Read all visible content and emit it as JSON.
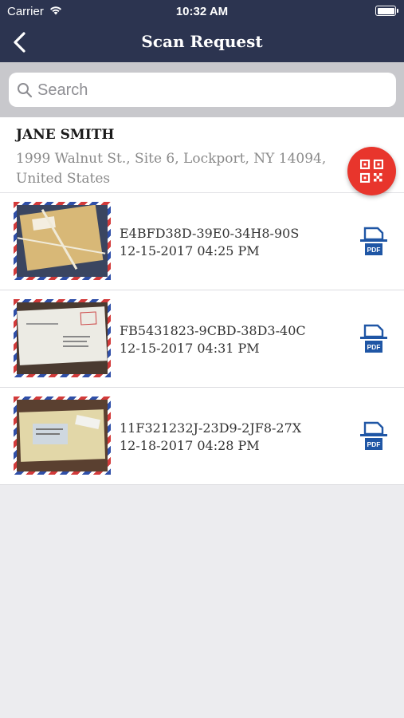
{
  "status_bar": {
    "carrier": "Carrier",
    "time": "10:32 AM"
  },
  "nav": {
    "title": "Scan Request"
  },
  "search": {
    "placeholder": "Search",
    "value": ""
  },
  "customer": {
    "name": "JANE SMITH",
    "address": "1999 Walnut St., Site 6, Lockport, NY 14094, United States"
  },
  "scans": [
    {
      "id": "E4BFD38D-39E0-34H8-90S",
      "date": "12-15-2017 04:25 PM"
    },
    {
      "id": "FB5431823-9CBD-38D3-40C",
      "date": "12-15-2017 04:31 PM"
    },
    {
      "id": "11F321232J-23D9-2JF8-27X",
      "date": "12-18-2017 04:28 PM"
    }
  ],
  "pdf_label": "PDF",
  "colors": {
    "navbar": "#2c3450",
    "accent": "#e8352c",
    "pdf_blue": "#1f56a5"
  },
  "icons": {
    "back": "chevron-left-icon",
    "search": "search-icon",
    "qr": "qr-scan-icon",
    "pdf": "pdf-file-icon",
    "wifi": "wifi-icon",
    "battery": "battery-icon"
  }
}
